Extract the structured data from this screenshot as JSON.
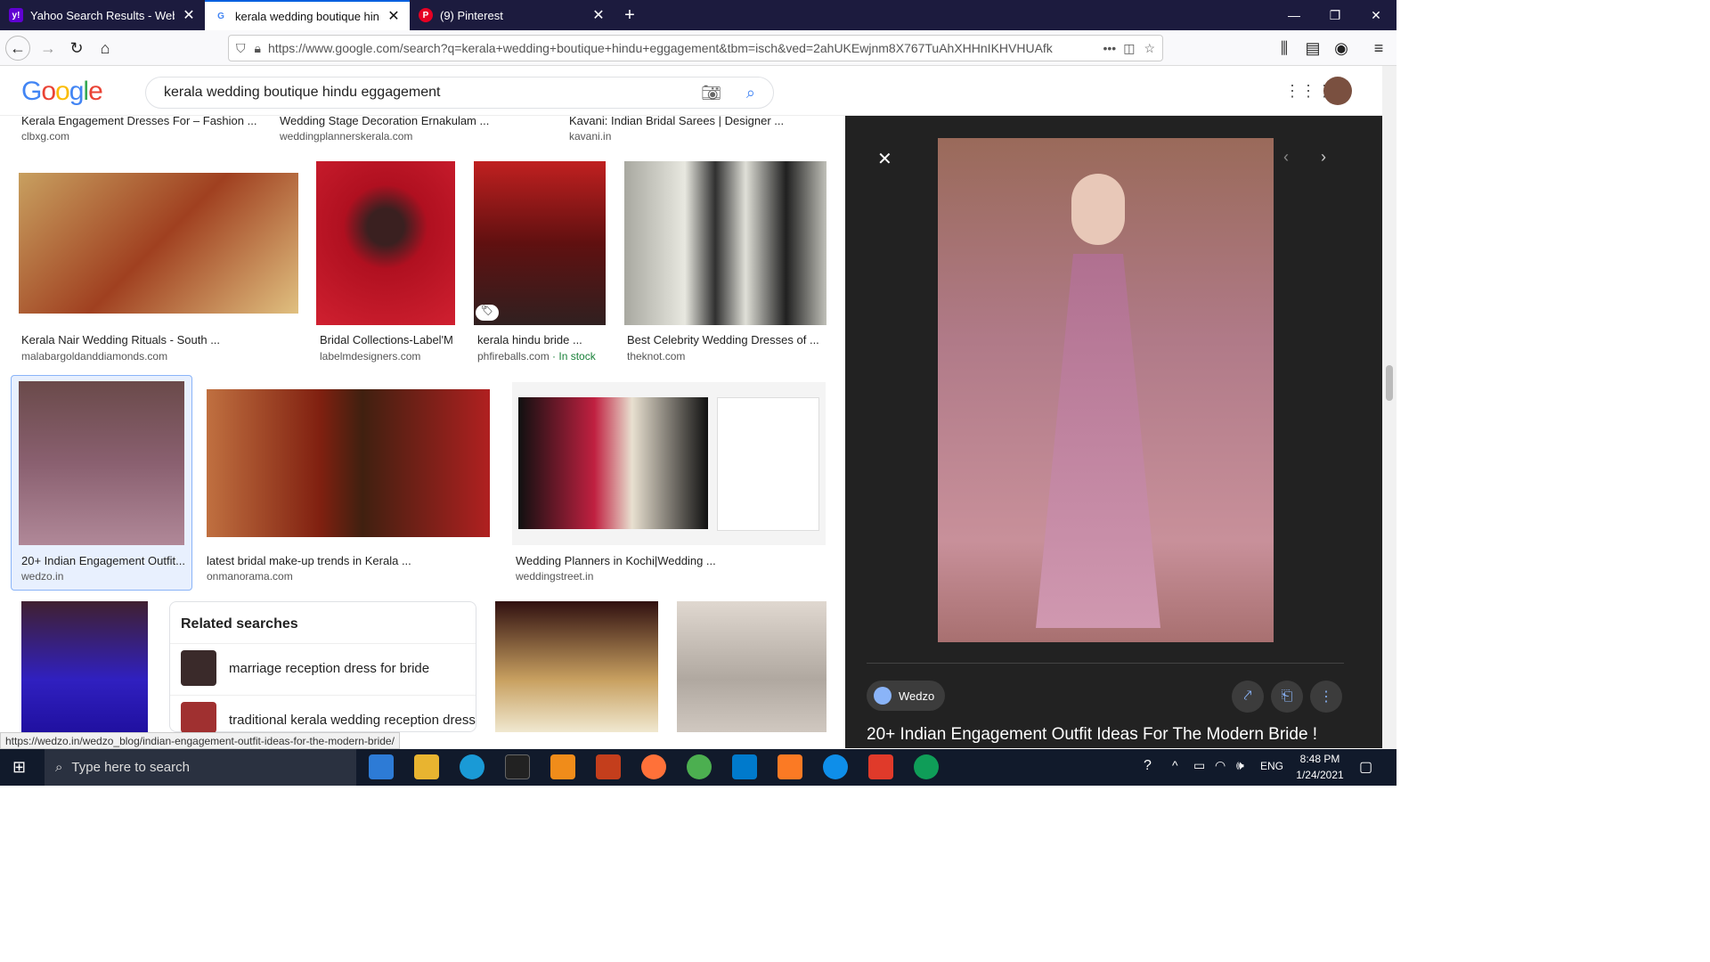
{
  "tabs": [
    {
      "title": "Yahoo Search Results - Web sea",
      "favicon": "y!"
    },
    {
      "title": "kerala wedding boutique hindu",
      "favicon": "G"
    },
    {
      "title": "(9) Pinterest",
      "favicon": "P"
    }
  ],
  "url": "https://www.google.com/search?q=kerala+wedding+boutique+hindu+eggagement&tbm=isch&ved=2ahUKEwjnm8X767TuAhXHHnIKHVHUAfk",
  "search": {
    "query": "kerala wedding boutique hindu eggagement"
  },
  "logo": "Google",
  "top_row": [
    {
      "title": "Kerala Engagement Dresses For – Fashion ...",
      "source": "clbxg.com"
    },
    {
      "title": "Wedding Stage Decoration Ernakulam ...",
      "source": "weddingplannerskerala.com"
    },
    {
      "title": "Kavani: Indian Bridal Sarees | Designer ...",
      "source": "kavani.in"
    }
  ],
  "row2": [
    {
      "title": "Kerala Nair Wedding Rituals - South ...",
      "source": "malabargoldanddiamonds.com",
      "color": "#b0703a"
    },
    {
      "title": "Bridal Collections-Label'M",
      "source": "labelmdesigners.com",
      "color": "#c0202a"
    },
    {
      "title": "kerala hindu bride ...",
      "source": "phfireballs.com",
      "stock": "· In stock",
      "color": "#9a2a20"
    },
    {
      "title": "Best Celebrity Wedding Dresses of ...",
      "source": "theknot.com",
      "color": "#8a8a80"
    }
  ],
  "row3": [
    {
      "title": "20+ Indian Engagement Outfit...",
      "source": "wedzo.in",
      "color": "#8a5a6a"
    },
    {
      "title": "latest bridal make-up trends in Kerala ...",
      "source": "onmanorama.com",
      "color": "#8a2a1a"
    },
    {
      "title": "Wedding Planners in Kochi|Wedding ...",
      "source": "weddingstreet.in",
      "color": "#2a2a2a"
    }
  ],
  "related": {
    "heading": "Related searches",
    "items": [
      "marriage reception dress for bride",
      "traditional kerala wedding reception dress"
    ]
  },
  "panel": {
    "site": "Wedzo",
    "title": "20+ Indian Engagement Outfit Ideas For The Modern Bride !",
    "image_color": "#b07a88"
  },
  "status_url": "https://wedzo.in/wedzo_blog/indian-engagement-outfit-ideas-for-the-modern-bride/",
  "taskbar": {
    "search_placeholder": "Type here to search",
    "lang": "ENG",
    "time": "8:48 PM",
    "date": "1/24/2021"
  }
}
